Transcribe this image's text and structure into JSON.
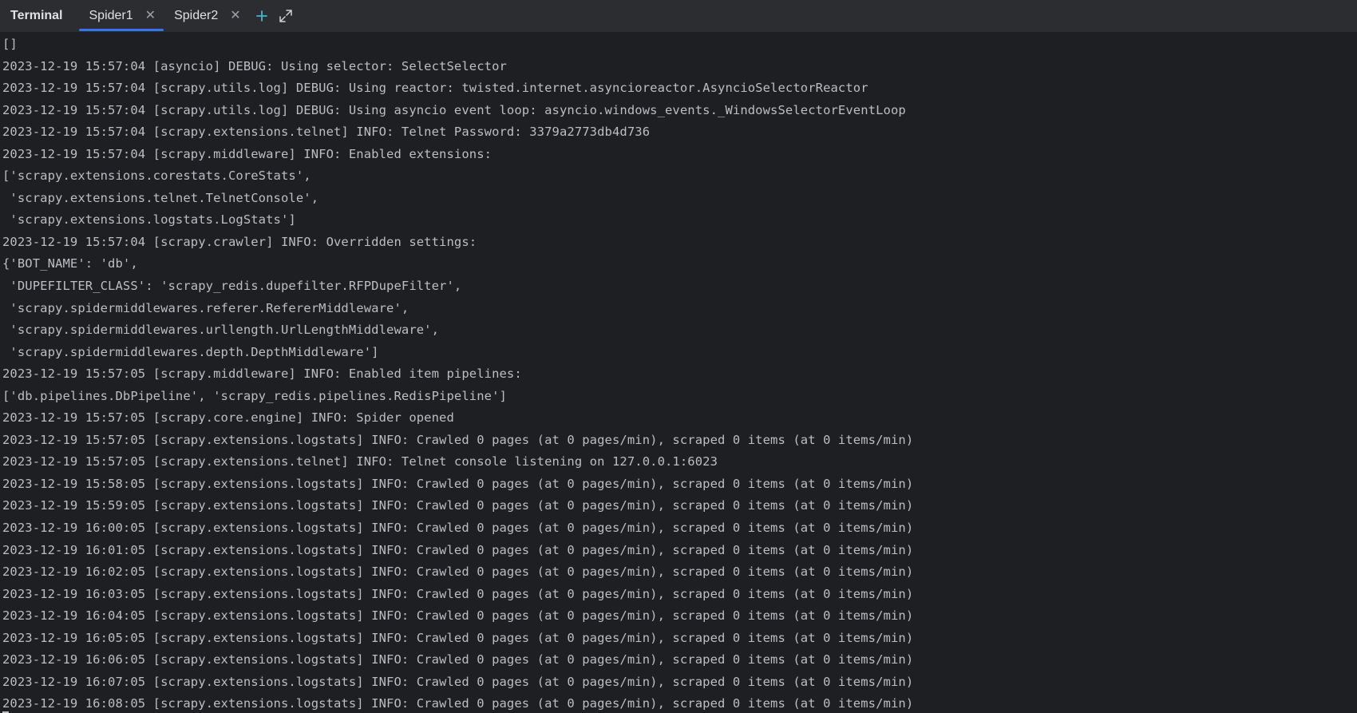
{
  "toolwindow": {
    "title": "Terminal",
    "tabs": [
      {
        "label": "Spider1",
        "active": true,
        "close_icon": "close-icon"
      },
      {
        "label": "Spider2",
        "active": false,
        "close_icon": "close-icon"
      }
    ],
    "new_tab_icon": "plus-icon",
    "maximize_icon": "expand-icon",
    "accent_color": "#3574f0",
    "plus_color": "#3fb6d2"
  },
  "console": {
    "lines": [
      "[]",
      "2023-12-19 15:57:04 [asyncio] DEBUG: Using selector: SelectSelector",
      "2023-12-19 15:57:04 [scrapy.utils.log] DEBUG: Using reactor: twisted.internet.asyncioreactor.AsyncioSelectorReactor",
      "2023-12-19 15:57:04 [scrapy.utils.log] DEBUG: Using asyncio event loop: asyncio.windows_events._WindowsSelectorEventLoop",
      "2023-12-19 15:57:04 [scrapy.extensions.telnet] INFO: Telnet Password: 3379a2773db4d736",
      "2023-12-19 15:57:04 [scrapy.middleware] INFO: Enabled extensions:",
      "['scrapy.extensions.corestats.CoreStats',",
      " 'scrapy.extensions.telnet.TelnetConsole',",
      " 'scrapy.extensions.logstats.LogStats']",
      "2023-12-19 15:57:04 [scrapy.crawler] INFO: Overridden settings:",
      "{'BOT_NAME': 'db',",
      " 'DUPEFILTER_CLASS': 'scrapy_redis.dupefilter.RFPDupeFilter',",
      " 'scrapy.spidermiddlewares.referer.RefererMiddleware',",
      " 'scrapy.spidermiddlewares.urllength.UrlLengthMiddleware',",
      " 'scrapy.spidermiddlewares.depth.DepthMiddleware']",
      "2023-12-19 15:57:05 [scrapy.middleware] INFO: Enabled item pipelines:",
      "['db.pipelines.DbPipeline', 'scrapy_redis.pipelines.RedisPipeline']",
      "2023-12-19 15:57:05 [scrapy.core.engine] INFO: Spider opened",
      "2023-12-19 15:57:05 [scrapy.extensions.logstats] INFO: Crawled 0 pages (at 0 pages/min), scraped 0 items (at 0 items/min)",
      "2023-12-19 15:57:05 [scrapy.extensions.telnet] INFO: Telnet console listening on 127.0.0.1:6023",
      "2023-12-19 15:58:05 [scrapy.extensions.logstats] INFO: Crawled 0 pages (at 0 pages/min), scraped 0 items (at 0 items/min)",
      "2023-12-19 15:59:05 [scrapy.extensions.logstats] INFO: Crawled 0 pages (at 0 pages/min), scraped 0 items (at 0 items/min)",
      "2023-12-19 16:00:05 [scrapy.extensions.logstats] INFO: Crawled 0 pages (at 0 pages/min), scraped 0 items (at 0 items/min)",
      "2023-12-19 16:01:05 [scrapy.extensions.logstats] INFO: Crawled 0 pages (at 0 pages/min), scraped 0 items (at 0 items/min)",
      "2023-12-19 16:02:05 [scrapy.extensions.logstats] INFO: Crawled 0 pages (at 0 pages/min), scraped 0 items (at 0 items/min)",
      "2023-12-19 16:03:05 [scrapy.extensions.logstats] INFO: Crawled 0 pages (at 0 pages/min), scraped 0 items (at 0 items/min)",
      "2023-12-19 16:04:05 [scrapy.extensions.logstats] INFO: Crawled 0 pages (at 0 pages/min), scraped 0 items (at 0 items/min)",
      "2023-12-19 16:05:05 [scrapy.extensions.logstats] INFO: Crawled 0 pages (at 0 pages/min), scraped 0 items (at 0 items/min)",
      "2023-12-19 16:06:05 [scrapy.extensions.logstats] INFO: Crawled 0 pages (at 0 pages/min), scraped 0 items (at 0 items/min)",
      "2023-12-19 16:07:05 [scrapy.extensions.logstats] INFO: Crawled 0 pages (at 0 pages/min), scraped 0 items (at 0 items/min)",
      "2023-12-19 16:08:05 [scrapy.extensions.logstats] INFO: Crawled 0 pages (at 0 pages/min), scraped 0 items (at 0 items/min)"
    ]
  }
}
